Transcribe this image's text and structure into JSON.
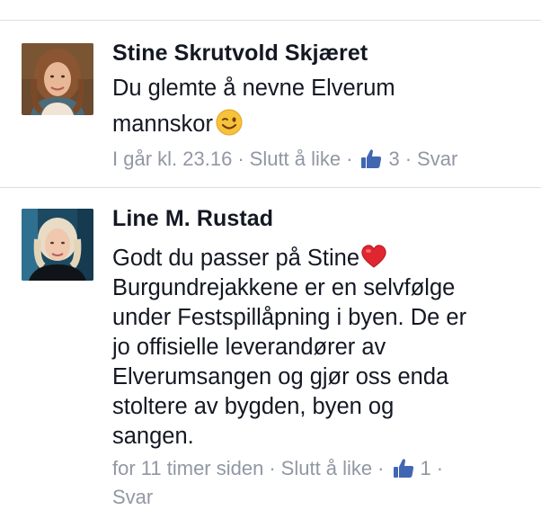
{
  "comments": [
    {
      "author": "Stine Skrutvold Skjæret",
      "text_lines": [
        "Du glemte å nevne Elverum",
        "mannskor"
      ],
      "emoji": "wink-emoji",
      "time": "I går kl. 23.16",
      "like_action": "Slutt å like",
      "like_count": "3",
      "reply": "Svar",
      "separator": "·"
    },
    {
      "author": "Line M. Rustad",
      "text_lines": [
        "Godt du passer på Stine",
        "Burgundrejakkene er en selvfølge",
        "under Festspillåpning i byen. De er",
        "jo offisielle leverandører av",
        "Elverumsangen og gjør oss enda",
        "stoltere av bygden, byen og",
        "sangen."
      ],
      "emoji": "red-heart-emoji",
      "time": "for 11 timer siden",
      "like_action": "Slutt å like",
      "like_count": "1",
      "reply": "Svar",
      "separator": "·"
    }
  ],
  "colors": {
    "author": "#141823",
    "meta": "#9197a3",
    "like_blue": "#4267b2",
    "divider": "#dcdee3"
  }
}
